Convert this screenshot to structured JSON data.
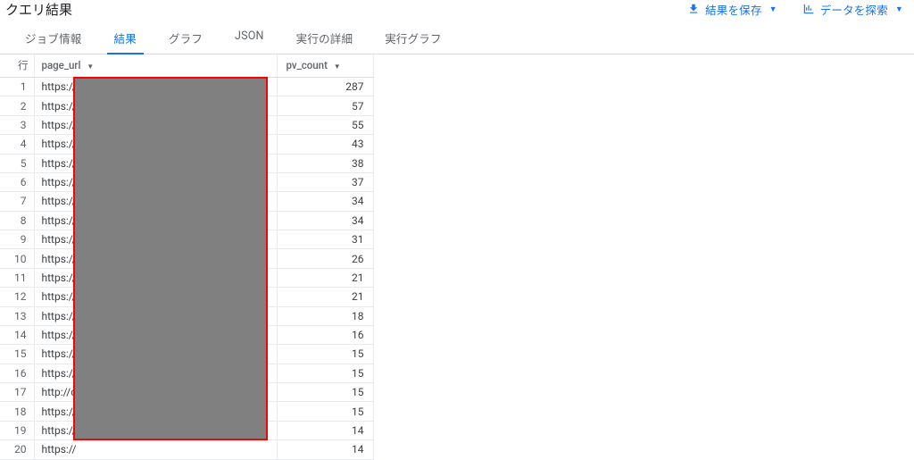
{
  "header": {
    "title": "クエリ結果",
    "save_label": "結果を保存",
    "explore_label": "データを探索"
  },
  "tabs": [
    {
      "id": "job",
      "label": "ジョブ情報"
    },
    {
      "id": "results",
      "label": "結果"
    },
    {
      "id": "graph",
      "label": "グラフ"
    },
    {
      "id": "json",
      "label": "JSON"
    },
    {
      "id": "details",
      "label": "実行の詳細"
    },
    {
      "id": "exgraph",
      "label": "実行グラフ"
    }
  ],
  "table": {
    "columns": {
      "row": "行",
      "page_url": "page_url",
      "pv_count": "pv_count"
    },
    "rows": [
      {
        "n": 1,
        "page_url": "https://",
        "pv_count": 287
      },
      {
        "n": 2,
        "page_url": "https://",
        "pv_count": 57
      },
      {
        "n": 3,
        "page_url": "https://",
        "pv_count": 55
      },
      {
        "n": 4,
        "page_url": "https://",
        "pv_count": 43
      },
      {
        "n": 5,
        "page_url": "https://",
        "pv_count": 38
      },
      {
        "n": 6,
        "page_url": "https://",
        "pv_count": 37
      },
      {
        "n": 7,
        "page_url": "https://",
        "pv_count": 34
      },
      {
        "n": 8,
        "page_url": "https://",
        "pv_count": 34
      },
      {
        "n": 9,
        "page_url": "https://",
        "pv_count": 31
      },
      {
        "n": 10,
        "page_url": "https://",
        "pv_count": 26
      },
      {
        "n": 11,
        "page_url": "https://",
        "pv_count": 21
      },
      {
        "n": 12,
        "page_url": "https://",
        "pv_count": 21
      },
      {
        "n": 13,
        "page_url": "https://",
        "pv_count": 18
      },
      {
        "n": 14,
        "page_url": "https://",
        "pv_count": 16
      },
      {
        "n": 15,
        "page_url": "https://",
        "pv_count": 15
      },
      {
        "n": 16,
        "page_url": "https://",
        "pv_count": 15
      },
      {
        "n": 17,
        "page_url": "http://d",
        "pv_count": 15
      },
      {
        "n": 18,
        "page_url": "https://",
        "pv_count": 15
      },
      {
        "n": 19,
        "page_url": "https://",
        "pv_count": 14
      },
      {
        "n": 20,
        "page_url": "https://",
        "pv_count": 14
      }
    ]
  }
}
